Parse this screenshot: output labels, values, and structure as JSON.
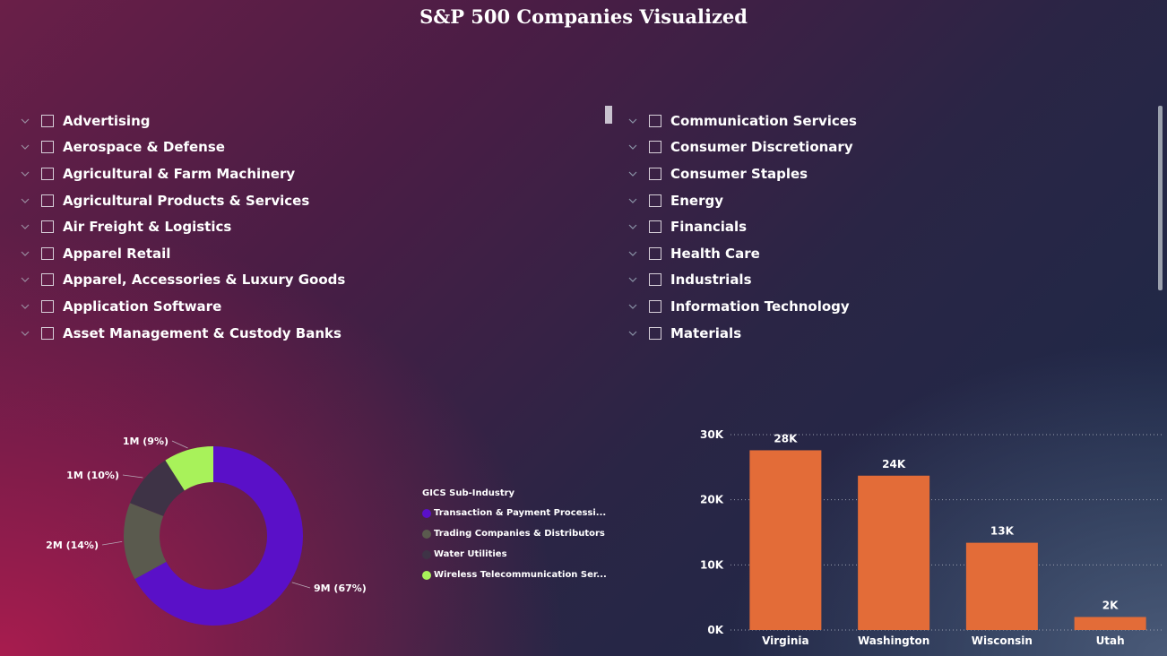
{
  "title": "S&P 500 Companies Visualized",
  "sub_industry_slicer": {
    "items": [
      "Advertising",
      "Aerospace & Defense",
      "Agricultural & Farm Machinery",
      "Agricultural Products & Services",
      "Air Freight & Logistics",
      "Apparel Retail",
      "Apparel, Accessories & Luxury Goods",
      "Application Software",
      "Asset Management & Custody Banks"
    ]
  },
  "sector_slicer": {
    "items": [
      "Communication Services",
      "Consumer Discretionary",
      "Consumer Staples",
      "Energy",
      "Financials",
      "Health Care",
      "Industrials",
      "Information Technology",
      "Materials"
    ]
  },
  "colors": {
    "transaction": "#5a10c8",
    "trading": "#5a5a4e",
    "water": "#3e3346",
    "wireless": "#a8f25a",
    "bar": "#e36c38"
  },
  "chart_data": [
    {
      "type": "pie",
      "legend_title": "GICS Sub-Industry",
      "series": [
        {
          "name": "Transaction & Payment Processi...",
          "value": 9,
          "label": "9M (67%)",
          "color": "#5a10c8"
        },
        {
          "name": "Trading Companies & Distributors",
          "value": 2,
          "label": "2M (14%)",
          "color": "#5a5a4e"
        },
        {
          "name": "Water Utilities",
          "value": 1,
          "label": "1M (10%)",
          "color": "#3e3346"
        },
        {
          "name": "Wireless Telecommunication Ser...",
          "value": 1,
          "label": "1M (9%)",
          "color": "#a8f25a"
        }
      ],
      "percents": [
        67,
        14,
        10,
        9
      ]
    },
    {
      "type": "bar",
      "categories": [
        "Virginia",
        "Washington",
        "Wisconsin",
        "Utah"
      ],
      "values": [
        27600,
        23700,
        13400,
        2000
      ],
      "data_labels": [
        "28K",
        "24K",
        "13K",
        "2K"
      ],
      "yticks": [
        "0K",
        "10K",
        "20K",
        "30K"
      ],
      "ylim": [
        0,
        30000
      ],
      "grid": true
    }
  ]
}
